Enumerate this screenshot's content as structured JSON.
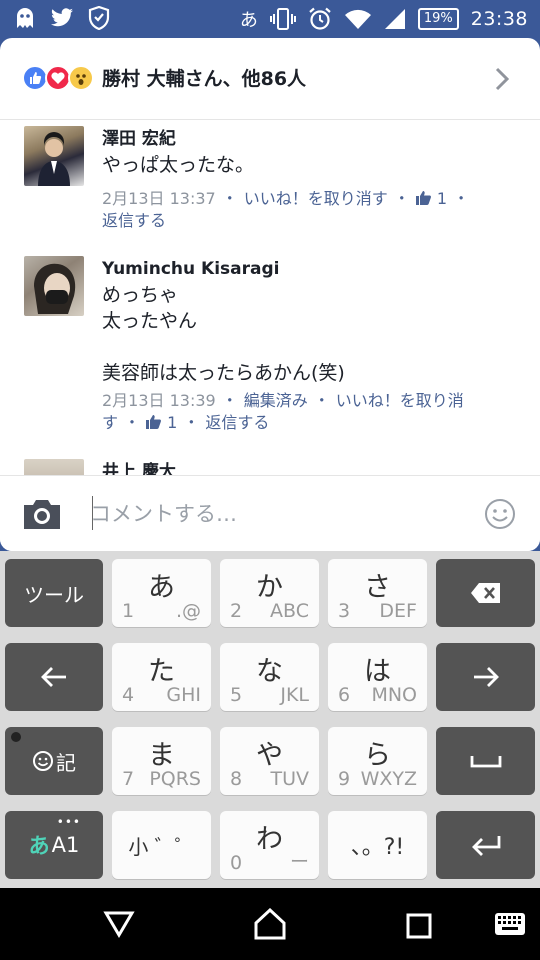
{
  "status_bar": {
    "ime_indicator": "あ",
    "battery": "19%",
    "clock": "23:38",
    "icons": [
      "ghost-app-icon",
      "twitter-icon",
      "shield-icon",
      "vibrate-icon",
      "alarm-icon",
      "wifi-icon",
      "signal-icon",
      "battery-icon"
    ]
  },
  "reactions": {
    "label": "勝村 大輔さん、他86人",
    "icons": [
      "like-reaction-icon",
      "love-reaction-icon",
      "wow-reaction-icon"
    ]
  },
  "comments": [
    {
      "name": "澤田 宏紀",
      "text": "やっぱ太ったな。",
      "timestamp": "2月13日 13:37",
      "unlike": "いいね！を取り消す",
      "like_count": "1",
      "reply": "返信する"
    },
    {
      "name": "Yuminchu Kisaragi",
      "text": "めっちゃ\n太ったやん\n\n美容師は太ったらあかん(笑)",
      "timestamp": "2月13日 13:39",
      "edited": "編集済み",
      "unlike_line1": "いいね！を取り消",
      "unlike_line2": "す",
      "like_count": "1",
      "reply": "返信する"
    },
    {
      "name": "井上 慶大"
    }
  ],
  "comment_input": {
    "placeholder": "コメントする…"
  },
  "keyboard": {
    "tool": "ツール",
    "emoji_label": "記",
    "mode_primary": "あ",
    "mode_secondary": "A1",
    "keys": [
      {
        "kana": "あ",
        "num": "1",
        "sub": ".@"
      },
      {
        "kana": "か",
        "num": "2",
        "sub": "ABC"
      },
      {
        "kana": "さ",
        "num": "3",
        "sub": "DEF"
      },
      {
        "kana": "た",
        "num": "4",
        "sub": "GHI"
      },
      {
        "kana": "な",
        "num": "5",
        "sub": "JKL"
      },
      {
        "kana": "は",
        "num": "6",
        "sub": "MNO"
      },
      {
        "kana": "ま",
        "num": "7",
        "sub": "PQRS"
      },
      {
        "kana": "や",
        "num": "8",
        "sub": "TUV"
      },
      {
        "kana": "ら",
        "num": "9",
        "sub": "WXYZ"
      },
      {
        "kana": "小 ゛゜",
        "num": "",
        "sub": ""
      },
      {
        "kana": "わ",
        "num": "0",
        "sub": "ー"
      },
      {
        "kana": "、。?!",
        "num": "",
        "sub": ""
      }
    ]
  },
  "colors": {
    "brand": "#3b5998",
    "link": "#4b6394",
    "meta": "#8d949e",
    "key_dark": "#545454",
    "key_light": "#fbfbfb"
  }
}
